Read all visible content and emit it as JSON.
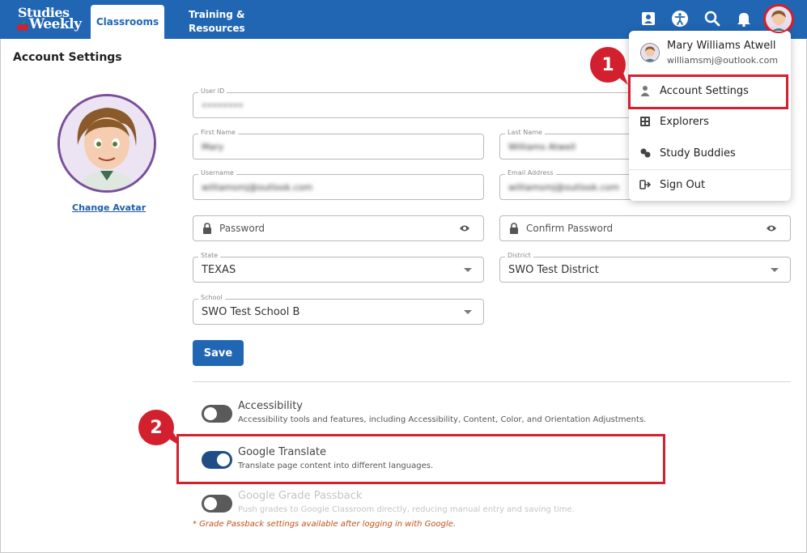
{
  "header": {
    "logo_line1": "Studies",
    "logo_line2": "Weekly",
    "tab_classrooms": "Classrooms",
    "tab_training_line1": "Training &",
    "tab_training_line2": "Resources",
    "icons": [
      "contact-card-icon",
      "accessibility-icon",
      "search-icon",
      "bell-icon"
    ],
    "brand_color": "#2166b3"
  },
  "page": {
    "title": "Account Settings",
    "change_avatar": "Change Avatar"
  },
  "form": {
    "user_id": {
      "label": "User ID",
      "value": "••••••••"
    },
    "first_name": {
      "label": "First Name",
      "value": "Mary"
    },
    "last_name": {
      "label": "Last Name",
      "value": "Williams Atwell"
    },
    "username": {
      "label": "Username",
      "value": "williamsmj@outlook.com"
    },
    "email": {
      "label": "Email Address",
      "value": "williamsmj@outlook.com"
    },
    "password": {
      "placeholder": "Password"
    },
    "confirm_password": {
      "placeholder": "Confirm Password"
    },
    "state": {
      "label": "State",
      "value": "TEXAS"
    },
    "district": {
      "label": "District",
      "value": "SWO Test District"
    },
    "school": {
      "label": "School",
      "value": "SWO Test School B"
    },
    "save_label": "Save"
  },
  "toggles": [
    {
      "title": "Accessibility",
      "desc": "Accessibility tools and features, including Accessibility, Content, Color, and Orientation Adjustments.",
      "on": false,
      "enabled": true
    },
    {
      "title": "Google Translate",
      "desc": "Translate page content into different languages.",
      "on": true,
      "enabled": true
    },
    {
      "title": "Google Grade Passback",
      "desc": "Push grades to Google Classroom directly, reducing manual entry and saving time.",
      "on": false,
      "enabled": false
    }
  ],
  "note": "* Grade Passback settings available after logging in with Google.",
  "menu": {
    "user_name": "Mary Williams Atwell",
    "user_email": "williamsmj@outlook.com",
    "items": [
      {
        "label": "Account Settings",
        "icon": "person-icon"
      },
      {
        "label": "Explorers",
        "icon": "explorers-icon"
      },
      {
        "label": "Study Buddies",
        "icon": "study-buddies-icon"
      },
      {
        "label": "Sign Out",
        "icon": "sign-out-icon"
      }
    ]
  },
  "annotations": {
    "badge_1": "1",
    "badge_2": "2",
    "color": "#d2202e"
  }
}
